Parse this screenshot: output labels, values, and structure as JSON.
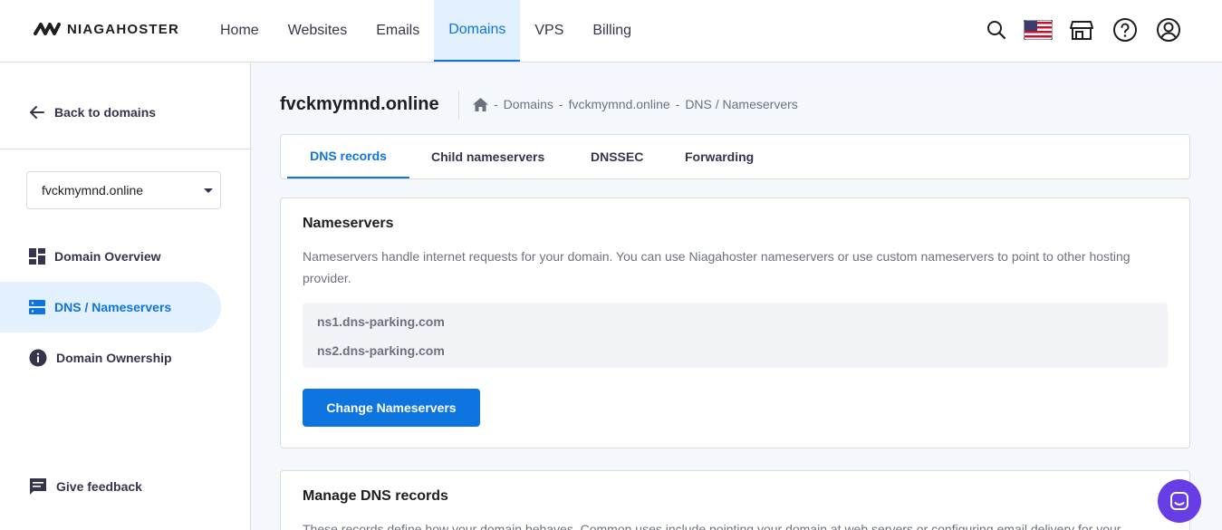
{
  "header": {
    "logo_text": "NIAGAHOSTER",
    "nav": [
      {
        "label": "Home"
      },
      {
        "label": "Websites"
      },
      {
        "label": "Emails"
      },
      {
        "label": "Domains"
      },
      {
        "label": "VPS"
      },
      {
        "label": "Billing"
      }
    ],
    "active_nav": "Domains",
    "icons": [
      "search-icon",
      "us-flag-icon",
      "store-icon",
      "help-icon",
      "account-icon"
    ]
  },
  "sidebar": {
    "back_label": "Back to domains",
    "domain_select_value": "fvckmymnd.online",
    "items": [
      {
        "label": "Domain Overview",
        "icon": "grid-icon"
      },
      {
        "label": "DNS / Nameservers",
        "icon": "dns-icon"
      },
      {
        "label": "Domain Ownership",
        "icon": "info-icon"
      }
    ],
    "active_item": "DNS / Nameservers",
    "feedback_label": "Give feedback"
  },
  "main": {
    "title": "fvckmymnd.online",
    "breadcrumb": {
      "sep": "-",
      "items": [
        "Domains",
        "fvckmymnd.online",
        "DNS / Nameservers"
      ]
    },
    "tabs": [
      {
        "label": "DNS records"
      },
      {
        "label": "Child nameservers"
      },
      {
        "label": "DNSSEC"
      },
      {
        "label": "Forwarding"
      }
    ],
    "active_tab": "DNS records",
    "nameservers_card": {
      "title": "Nameservers",
      "description": "Nameservers handle internet requests for your domain. You can use Niagahoster nameservers or use custom nameservers to point to other hosting provider.",
      "nameservers": [
        "ns1.dns-parking.com",
        "ns2.dns-parking.com"
      ],
      "button_label": "Change Nameservers"
    },
    "dns_card": {
      "title": "Manage DNS records",
      "description": "These records define how your domain behaves. Common uses include pointing your domain at web servers or configuring email delivery for your"
    }
  },
  "colors": {
    "accent": "#0d74e0",
    "active_bg": "#e3f0fd",
    "chat": "#673de6",
    "text_dark": "#1d1e20",
    "text_muted": "#6d7081"
  }
}
